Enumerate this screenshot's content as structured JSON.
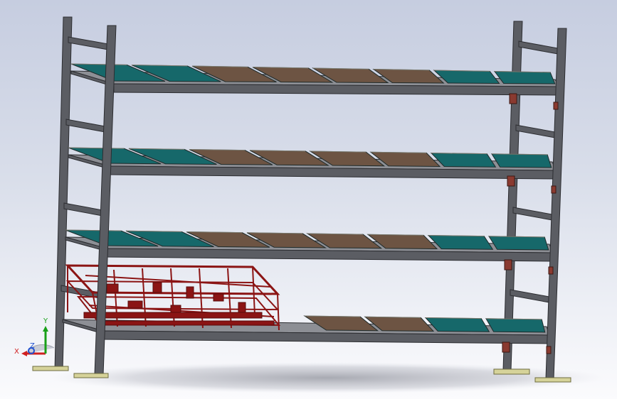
{
  "viewport": {
    "background_top": "#c6cde0",
    "background_bottom": "#fbfbfd"
  },
  "model": {
    "frame_color": "#5b5d63",
    "frame_edge_color": "#2c2d31",
    "foot_color": "#d6d39a",
    "tray_teal": "#16686a",
    "tray_brown": "#6d5443",
    "cart_color": "#8b1414",
    "joint_color": "#8a3a30"
  },
  "triad": {
    "x_label": "X",
    "y_label": "Y",
    "z_label": "Z",
    "x_color": "#d02020",
    "y_color": "#18a018",
    "z_color": "#2050d0"
  }
}
